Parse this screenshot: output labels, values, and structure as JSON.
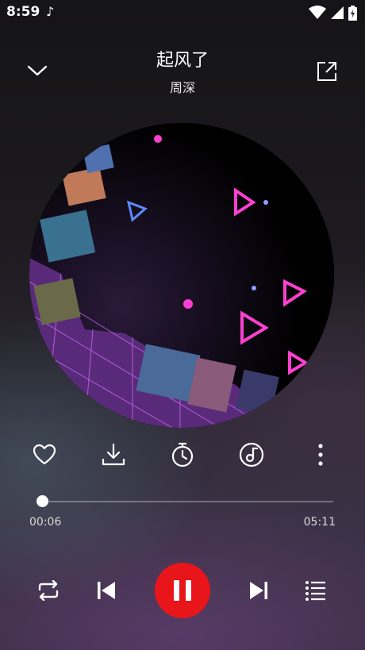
{
  "status_bar": {
    "time": "8:59",
    "icons": [
      "music-note-icon",
      "wifi-icon",
      "signal-icon",
      "battery-icon"
    ]
  },
  "header": {
    "song_title": "起风了",
    "artist": "周深",
    "icons": [
      "chevron-down-icon",
      "share-icon"
    ]
  },
  "actions": [
    "heart-icon",
    "download-icon",
    "timer-icon",
    "music-tag-icon",
    "more-vertical-icon"
  ],
  "progress": {
    "current": "00:06",
    "duration": "05:11",
    "fraction": 0.019
  },
  "controls": [
    "repeat-icon",
    "previous-icon",
    "pause-icon",
    "next-icon",
    "playlist-icon"
  ],
  "colors": {
    "accent": "#e8151b",
    "text": "#ffffff"
  }
}
